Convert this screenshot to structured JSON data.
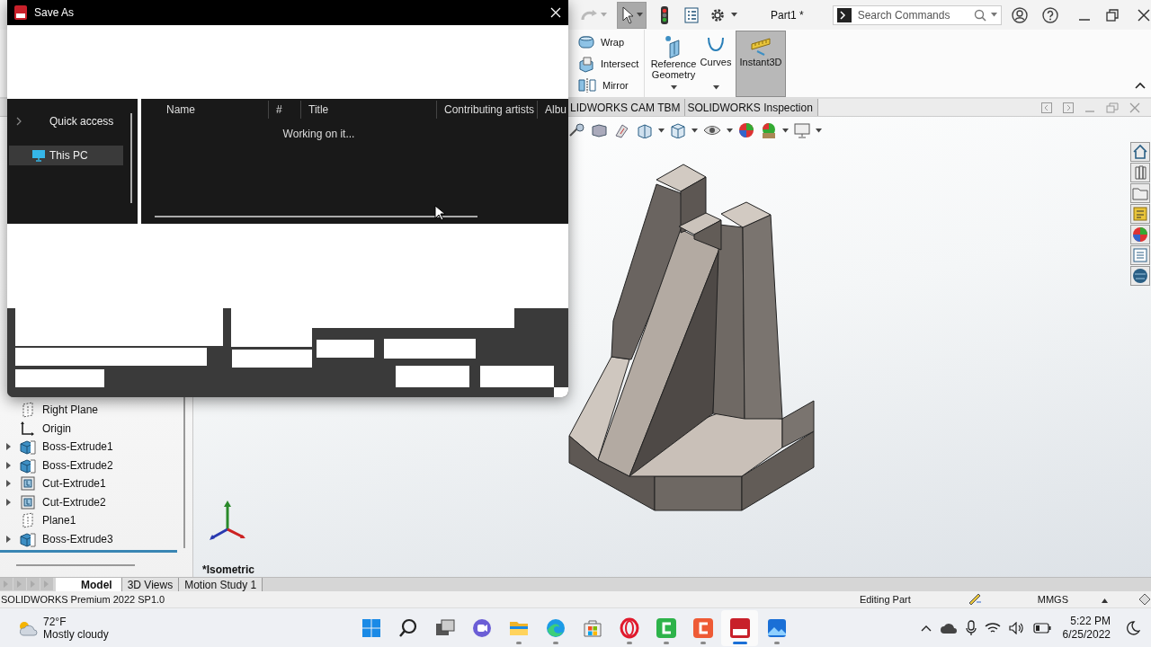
{
  "app": {
    "select_tool": {
      "selected": true
    },
    "title": "Part1 *",
    "search": {
      "placeholder": "Search Commands"
    },
    "ribbon": {
      "small_tools": [
        {
          "label": "Wrap",
          "kind": "wrap"
        },
        {
          "label": "Intersect",
          "kind": "intersect"
        },
        {
          "label": "Mirror",
          "kind": "mirror"
        }
      ],
      "large_tools": [
        {
          "label": "Reference Geometry",
          "kind": "reference",
          "dropdown": true,
          "selected": false
        },
        {
          "label": "Curves",
          "kind": "curves",
          "dropdown": true,
          "selected": false
        },
        {
          "label": "Instant3D",
          "kind": "instant3d",
          "dropdown": false,
          "selected": true
        }
      ]
    },
    "command_tabs": [
      {
        "label": "LIDWORKS CAM TBM"
      },
      {
        "label": "SOLIDWORKS Inspection"
      }
    ],
    "feature_tree": [
      {
        "label": "Right Plane",
        "kind": "plane",
        "expandable": false
      },
      {
        "label": "Origin",
        "kind": "origin",
        "expandable": false
      },
      {
        "label": "Boss-Extrude1",
        "kind": "boss",
        "expandable": true
      },
      {
        "label": "Boss-Extrude2",
        "kind": "boss",
        "expandable": true
      },
      {
        "label": "Cut-Extrude1",
        "kind": "cut",
        "expandable": true
      },
      {
        "label": "Cut-Extrude2",
        "kind": "cut",
        "expandable": true
      },
      {
        "label": "Plane1",
        "kind": "plane",
        "expandable": false
      },
      {
        "label": "Boss-Extrude3",
        "kind": "boss",
        "expandable": true
      }
    ],
    "view_label": "*Isometric",
    "bottom_tabs": [
      {
        "label": "Model",
        "selected": true
      },
      {
        "label": "3D Views",
        "selected": false
      },
      {
        "label": "Motion Study 1",
        "selected": false
      }
    ],
    "status_bar": {
      "product": "SOLIDWORKS Premium 2022 SP1.0",
      "mode": "Editing Part",
      "units": "MMGS"
    }
  },
  "dialog": {
    "title": "Save As",
    "nav": [
      {
        "label": "Quick access",
        "kind": "quick",
        "selected": false
      },
      {
        "label": "This PC",
        "kind": "pc",
        "selected": true
      }
    ],
    "columns": [
      "Name",
      "#",
      "Title",
      "Contributing artists",
      "Albu"
    ],
    "message": "Working on it..."
  },
  "taskbar": {
    "weather": {
      "temperature": "72°F",
      "condition": "Mostly cloudy"
    },
    "apps": [
      {
        "kind": "start",
        "running": false,
        "active": false
      },
      {
        "kind": "search",
        "running": false,
        "active": false
      },
      {
        "kind": "taskview",
        "running": false,
        "active": false
      },
      {
        "kind": "chat",
        "running": false,
        "active": false
      },
      {
        "kind": "explorer",
        "running": true,
        "active": false
      },
      {
        "kind": "edge",
        "running": true,
        "active": false
      },
      {
        "kind": "store",
        "running": false,
        "active": false
      },
      {
        "kind": "opera",
        "running": true,
        "active": false
      },
      {
        "kind": "camtasia",
        "running": true,
        "active": false
      },
      {
        "kind": "recorder",
        "running": true,
        "active": false
      },
      {
        "kind": "solidworks",
        "running": true,
        "active": true
      },
      {
        "kind": "photos",
        "running": true,
        "active": false
      }
    ],
    "time": "5:22 PM",
    "date": "6/25/2022"
  }
}
